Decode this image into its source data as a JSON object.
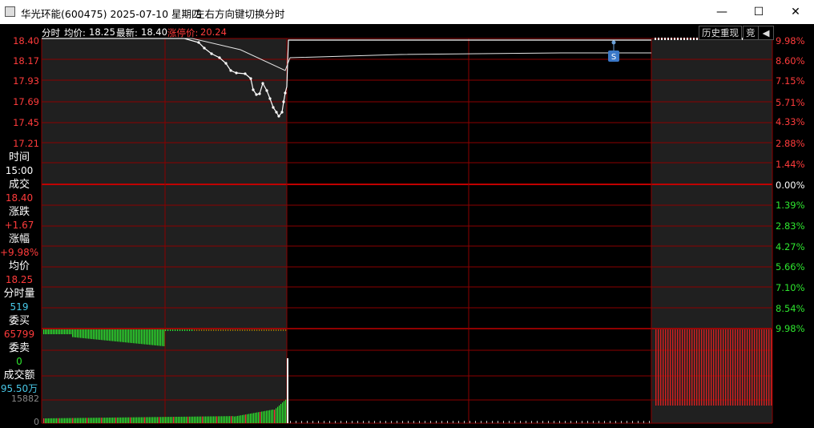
{
  "window": {
    "title": "华光环能(600475) 2025-07-10 星期四",
    "hint": "左右方向键切换分时",
    "min_label": "—",
    "max_label": "☐",
    "close_label": "✕"
  },
  "header": {
    "mode": "分时",
    "avg_label": "均价:",
    "avg_value": "18.25",
    "last_label": "最新:",
    "last_value": "18.40",
    "limit_label": "涨停价:",
    "limit_value": "20.24"
  },
  "toolbar": {
    "replay_label": "历史重现",
    "bid_label": "竞"
  },
  "price_axis": [
    "18.40",
    "18.17",
    "17.93",
    "17.69",
    "17.45",
    "17.21"
  ],
  "pct_axis_up": [
    "9.98%",
    "8.60%",
    "7.15%",
    "5.71%",
    "4.33%",
    "2.88%",
    "1.44%",
    "0.00%"
  ],
  "pct_axis_down": [
    "1.39%",
    "2.83%",
    "4.27%",
    "5.66%",
    "7.10%",
    "8.54%",
    "9.98%"
  ],
  "volume_axis": [
    "15882",
    "0"
  ],
  "stats": [
    {
      "label": "时间",
      "value": "15:00",
      "color": "#ffffff"
    },
    {
      "label": "成交",
      "value": "18.40",
      "color": "#ff3b3b"
    },
    {
      "label": "涨跌",
      "value": "+1.67",
      "color": "#ff3b3b"
    },
    {
      "label": "涨幅",
      "value": "+9.98%",
      "color": "#ff3b3b"
    },
    {
      "label": "均价",
      "value": "18.25",
      "color": "#ff3b3b"
    },
    {
      "label": "分时量",
      "value": "519",
      "color": "#48c8e8"
    },
    {
      "label": "委买",
      "value": "65799",
      "color": "#ff3b3b"
    },
    {
      "label": "委卖",
      "value": "0",
      "color": "#2ee62e"
    },
    {
      "label": "成交额",
      "value": "95.50万",
      "color": "#48c8e8"
    }
  ],
  "marker_label": "S",
  "colors": {
    "up": "#ff3b3b",
    "down": "#2ee62e",
    "grid": "#8b0000",
    "price_line": "#ffffff",
    "shade": "#202020",
    "cyan": "#48c8e8"
  }
}
